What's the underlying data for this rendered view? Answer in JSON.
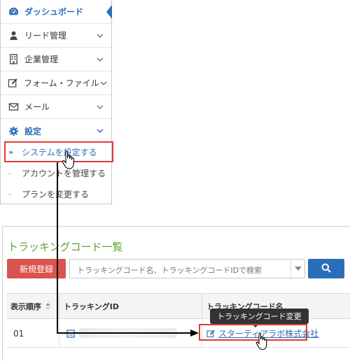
{
  "sidebar": {
    "items": [
      {
        "label": "ダッシュボード",
        "icon": "dashboard-icon",
        "active": true
      },
      {
        "label": "リード管理",
        "icon": "user-icon"
      },
      {
        "label": "企業管理",
        "icon": "building-icon"
      },
      {
        "label": "フォーム・ファイル",
        "icon": "edit-icon"
      },
      {
        "label": "メール",
        "icon": "mail-icon"
      },
      {
        "label": "設定",
        "icon": "gear-icon"
      }
    ],
    "submenu": [
      {
        "label": "システムを設定する",
        "bullet": "»",
        "current": true
      },
      {
        "label": "アカウントを管理する",
        "bullet": "-"
      },
      {
        "label": "プランを変更する",
        "bullet": "-"
      }
    ]
  },
  "tracking": {
    "title": "トラッキングコード一覧",
    "new_button": "新規登録",
    "search_placeholder": "トラッキングコード名、トラッキングコードIDで検索",
    "columns": [
      "表示順序",
      "トラッキングID",
      "トラッキングコード名"
    ],
    "rows": [
      {
        "order": "01",
        "name": "スターティアラボ株式会社"
      }
    ],
    "tooltip": "トラッキングコード変更"
  },
  "colors": {
    "accent_blue": "#2a6ebb",
    "title_green": "#5aa335",
    "new_button_red": "#d9534f",
    "highlight_red": "#e03a3a"
  }
}
